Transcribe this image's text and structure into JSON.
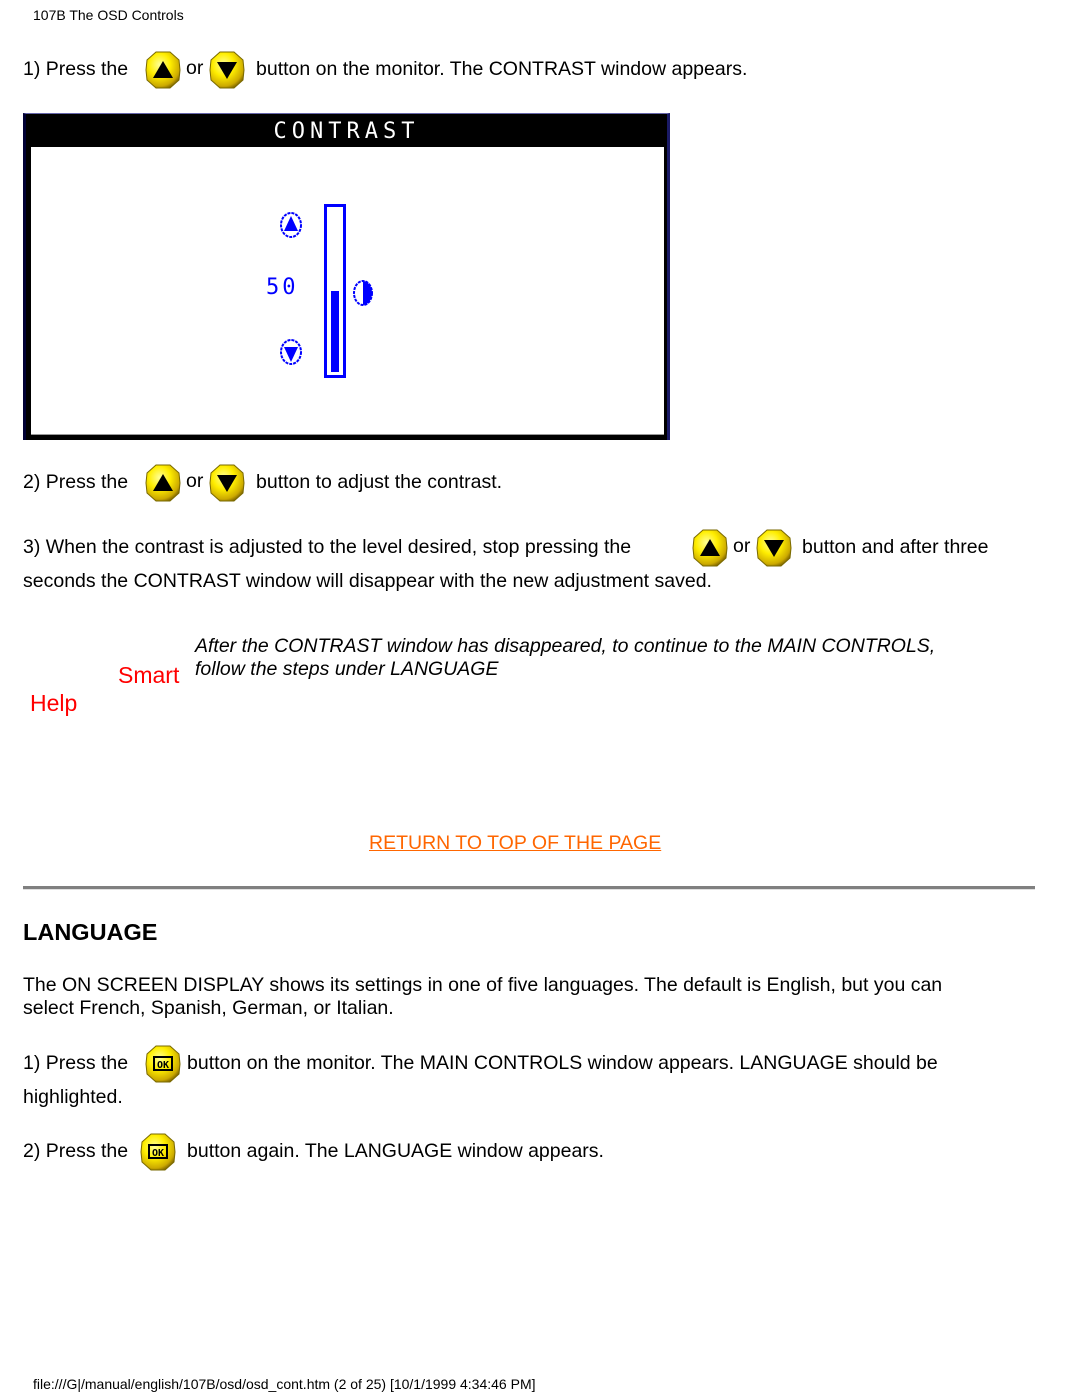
{
  "header": {
    "title": "107B The OSD Controls"
  },
  "contrast_section": {
    "step1": {
      "prefix": "1) Press the",
      "or": "or",
      "suffix": "button on the monitor. The CONTRAST window appears."
    },
    "osd_window": {
      "title": "CONTRAST",
      "value": "50",
      "level_fraction": 0.5,
      "accent_color": "#0000ff",
      "icons": [
        "up-arrow-icon",
        "down-arrow-icon",
        "contrast-half-circle-icon"
      ]
    },
    "step2": {
      "prefix": "2) Press the",
      "or": "or",
      "suffix": "button to adjust the contrast."
    },
    "step3": {
      "prefix": "3) When the contrast is adjusted to the level desired, stop pressing the",
      "or": "or",
      "suffix": "button and after three",
      "line2": "seconds the CONTRAST window will disappear with the new adjustment saved."
    },
    "smart_help": {
      "label_line1": "Smart",
      "label_line2": "Help",
      "text_line1": "After the CONTRAST window has disappeared, to continue to the MAIN CONTROLS,",
      "text_line2": "follow the steps under LANGUAGE",
      "label_color": "#ff0000"
    },
    "return_link": {
      "label": "RETURN TO TOP OF THE PAGE",
      "color": "#ff6600"
    }
  },
  "language_section": {
    "heading": "LANGUAGE",
    "intro_line1": "The ON SCREEN DISPLAY shows its settings in one of five languages. The default is English, but you can",
    "intro_line2": "select French, Spanish, German, or Italian.",
    "step1": {
      "prefix": "1) Press the",
      "suffix": "button on the monitor. The MAIN CONTROLS window appears. LANGUAGE should be",
      "line2": "highlighted."
    },
    "step2": {
      "prefix": "2) Press the",
      "suffix": "button again. The LANGUAGE window appears."
    }
  },
  "footer": {
    "text": "file:///G|/manual/english/107B/osd/osd_cont.htm (2 of 25) [10/1/1999 4:34:46 PM]"
  }
}
